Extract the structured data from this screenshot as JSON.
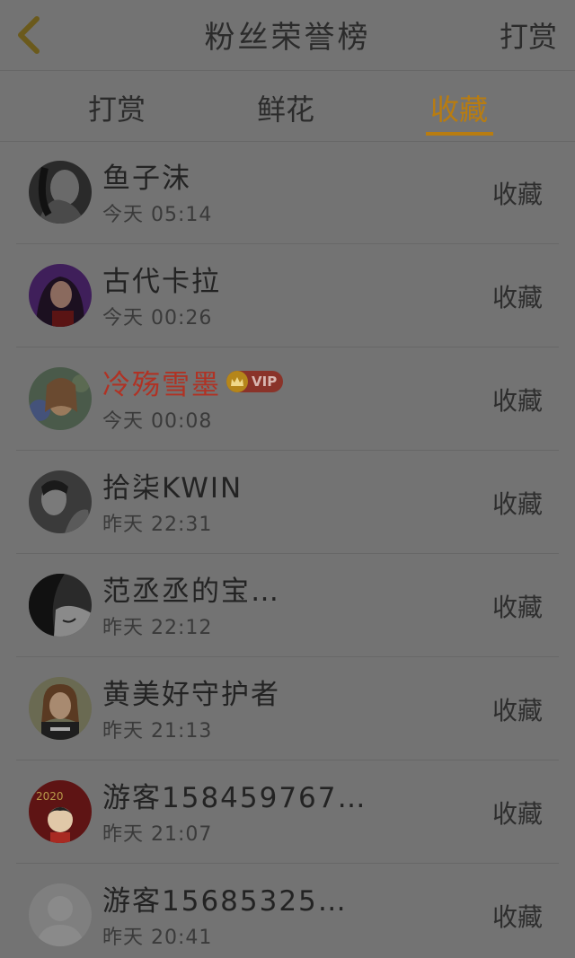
{
  "header": {
    "title": "粉丝荣誉榜",
    "action_label": "打赏",
    "back_icon": "chevron-left-icon"
  },
  "tabs": [
    {
      "label": "打赏",
      "active": false
    },
    {
      "label": "鲜花",
      "active": false
    },
    {
      "label": "收藏",
      "active": true
    }
  ],
  "colors": {
    "accent": "#b87c10",
    "vip_name": "#b03224",
    "background": "#737373"
  },
  "list": [
    {
      "name": "鱼子沫",
      "time": "今天 05:14",
      "action": "收藏",
      "vip": false
    },
    {
      "name": "古代卡拉",
      "time": "今天 00:26",
      "action": "收藏",
      "vip": false
    },
    {
      "name": "冷殇雪墨",
      "time": "今天 00:08",
      "action": "收藏",
      "vip": true,
      "badge": "VIP"
    },
    {
      "name": "拾柒KWIN",
      "time": "昨天 22:31",
      "action": "收藏",
      "vip": false
    },
    {
      "name": "范丞丞的宝…",
      "time": "昨天 22:12",
      "action": "收藏",
      "vip": false
    },
    {
      "name": "黄美好守护者",
      "time": "昨天 21:13",
      "action": "收藏",
      "vip": false
    },
    {
      "name": "游客158459767…",
      "time": "昨天 21:07",
      "action": "收藏",
      "vip": false
    },
    {
      "name": "游客15685325…",
      "time": "昨天 20:41",
      "action": "收藏",
      "vip": false
    }
  ]
}
